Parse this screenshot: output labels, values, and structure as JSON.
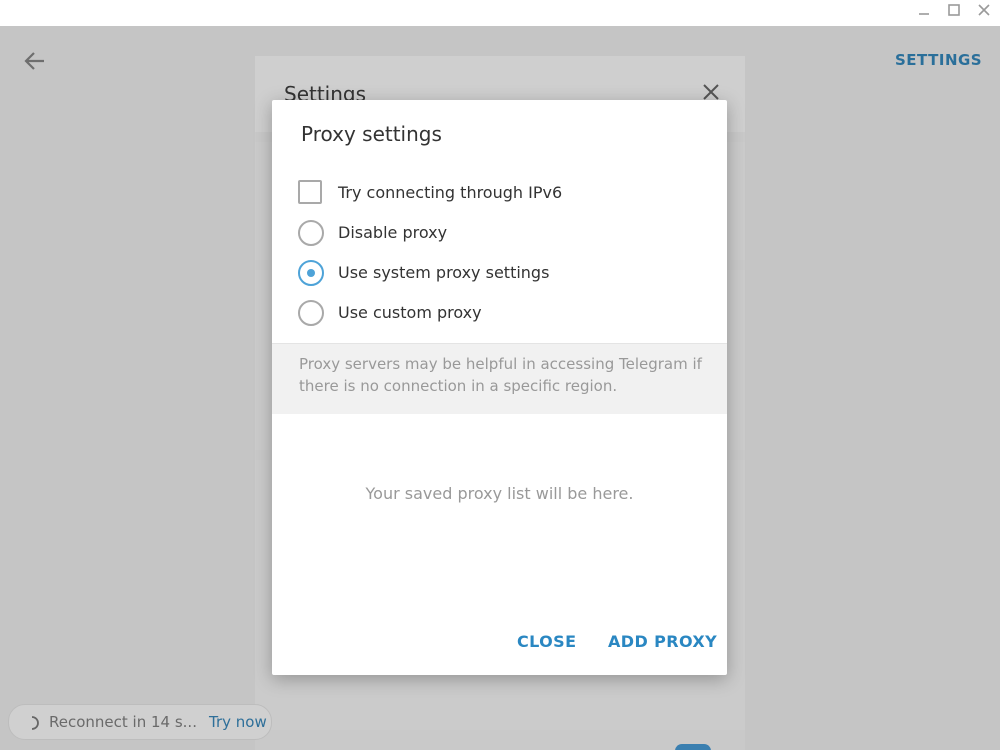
{
  "window": {
    "minimize_icon": "minimize-icon",
    "maximize_icon": "maximize-icon",
    "close_icon": "close-icon"
  },
  "header": {
    "back_icon": "arrow-left-icon",
    "settings_link": "SETTINGS"
  },
  "settings_panel": {
    "title": "Settings",
    "close_icon": "close-icon"
  },
  "reconnect": {
    "text": "Reconnect in 14 s...",
    "link": "Try now"
  },
  "proxy_dialog": {
    "title": "Proxy settings",
    "ipv6_checkbox": {
      "label": "Try connecting through IPv6",
      "checked": false
    },
    "options": [
      {
        "label": "Disable proxy",
        "selected": false
      },
      {
        "label": "Use system proxy settings",
        "selected": true
      },
      {
        "label": "Use custom proxy",
        "selected": false
      }
    ],
    "info": "Proxy servers may be helpful in accessing Telegram if there is no connection in a specific region.",
    "empty_list": "Your saved proxy list will be here.",
    "close_button": "CLOSE",
    "add_button": "ADD PROXY"
  },
  "colors": {
    "accent": "#4ea3d8",
    "button_text": "#2a87c2",
    "overlay_bg": "#c5c5c5"
  }
}
